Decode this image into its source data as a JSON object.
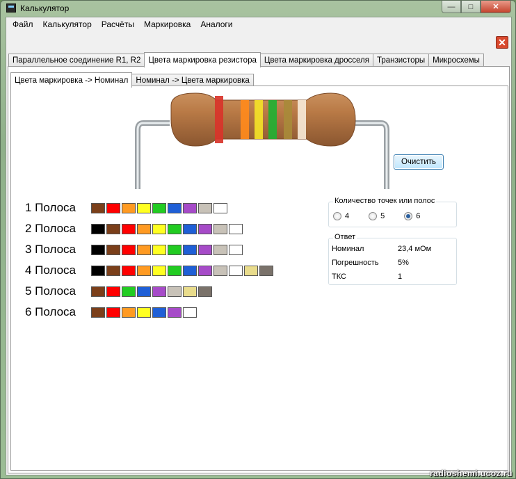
{
  "window": {
    "title": "Калькулятор",
    "btn_min": "—",
    "btn_max": "□",
    "btn_close": "✕"
  },
  "menu": [
    "Файл",
    "Калькулятор",
    "Расчёты",
    "Маркировка",
    "Аналоги"
  ],
  "tabs": [
    "Параллельное соединение R1, R2",
    "Цвета маркировка резистора",
    "Цвета маркировка дросселя",
    "Транзисторы",
    "Микросхемы"
  ],
  "active_tab": 1,
  "subtabs": [
    "Цвета маркировка -> Номинал",
    "Номинал -> Цвета маркировка"
  ],
  "active_subtab": 0,
  "clear_button": "Очистить",
  "resistor_bands": [
    "#d8342a",
    "#ff8a1c",
    "#f4e228",
    "#22b033",
    "#a88a3a",
    "#f6e8d6"
  ],
  "rows": [
    {
      "label": "1 Полоса",
      "colors": [
        "#7b3f1a",
        "#ff0000",
        "#ff9a22",
        "#ffff22",
        "#22cc22",
        "#1f5fd6",
        "#a64bc8",
        "#c8c2b8",
        "#ffffff"
      ]
    },
    {
      "label": "2 Полоса",
      "colors": [
        "#000000",
        "#7b3f1a",
        "#ff0000",
        "#ff9a22",
        "#ffff22",
        "#22cc22",
        "#1f5fd6",
        "#a64bc8",
        "#c8c2b8",
        "#ffffff"
      ]
    },
    {
      "label": "3 Полоса",
      "colors": [
        "#000000",
        "#7b3f1a",
        "#ff0000",
        "#ff9a22",
        "#ffff22",
        "#22cc22",
        "#1f5fd6",
        "#a64bc8",
        "#c8c2b8",
        "#ffffff"
      ]
    },
    {
      "label": "4 Полоса",
      "colors": [
        "#000000",
        "#7b3f1a",
        "#ff0000",
        "#ff9a22",
        "#ffff22",
        "#22cc22",
        "#1f5fd6",
        "#a64bc8",
        "#c8c2b8",
        "#ffffff",
        "#e9dc8c",
        "#7a726a"
      ]
    },
    {
      "label": "5 Полоса",
      "colors": [
        "#7b3f1a",
        "#ff0000",
        "#22cc22",
        "#1f5fd6",
        "#a64bc8",
        "#c8c2b8",
        "#e9dc8c",
        "#7a726a"
      ]
    },
    {
      "label": "6 Полоса",
      "colors": [
        "#7b3f1a",
        "#ff0000",
        "#ff9a22",
        "#ffff22",
        "#1f5fd6",
        "#a64bc8",
        "#ffffff"
      ]
    }
  ],
  "points_group": {
    "title": "Количество точек или полос",
    "options": [
      "4",
      "5",
      "6"
    ],
    "selected": "6"
  },
  "answer": {
    "title": "Ответ",
    "rows": [
      {
        "key": "Номинал",
        "value": "23,4 мОм"
      },
      {
        "key": "Погрешность",
        "value": "5%"
      },
      {
        "key": "ТКС",
        "value": "1"
      }
    ]
  },
  "watermark": "radioshemi.ucoz.ru"
}
